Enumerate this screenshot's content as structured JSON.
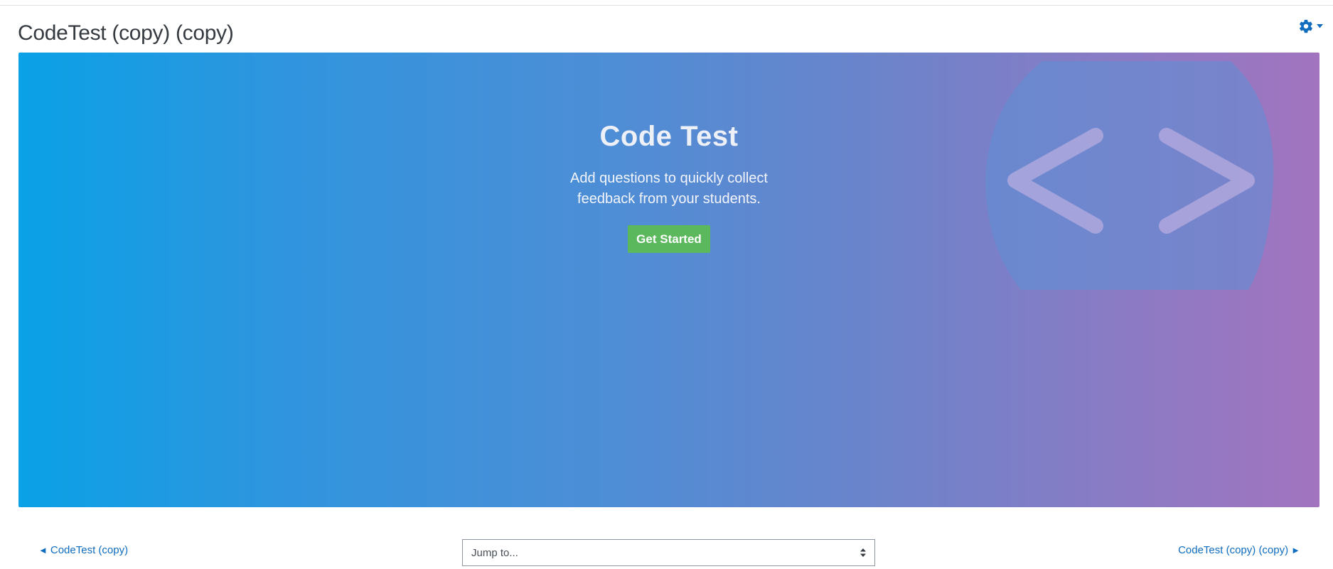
{
  "page": {
    "title": "CodeTest (copy) (copy)"
  },
  "settings": {
    "icon": "gear-icon",
    "caret_icon": "caret-down-icon",
    "color": "#0f6cbf"
  },
  "hero": {
    "title": "Code Test",
    "subtitle": "Add questions to quickly collect feedback from your students.",
    "button_label": "Get Started",
    "button_color": "#5cb85c",
    "gradient_start": "#0aa1e6",
    "gradient_end": "#a274bf",
    "decoration_icon": "code-brackets-icon"
  },
  "navigation": {
    "prev_label": "CodeTest (copy)",
    "next_label": "CodeTest (copy) (copy)",
    "prev_arrow": "◄",
    "next_arrow": "►",
    "link_color": "#0f6cbf"
  },
  "jump": {
    "value": "Jump to..."
  }
}
